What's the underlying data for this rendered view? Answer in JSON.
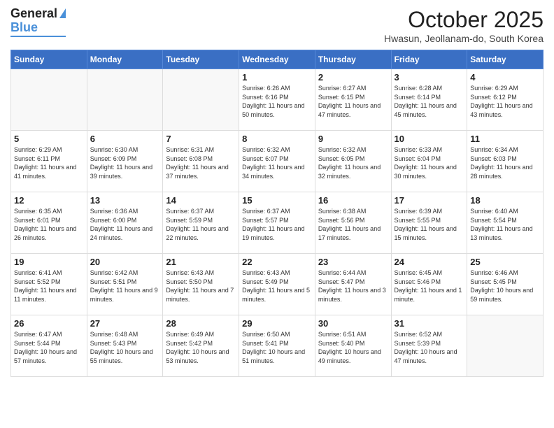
{
  "header": {
    "logo_general": "General",
    "logo_blue": "Blue",
    "month_title": "October 2025",
    "location": "Hwasun, Jeollanam-do, South Korea"
  },
  "days_of_week": [
    "Sunday",
    "Monday",
    "Tuesday",
    "Wednesday",
    "Thursday",
    "Friday",
    "Saturday"
  ],
  "weeks": [
    [
      {
        "day": "",
        "empty": true
      },
      {
        "day": "",
        "empty": true
      },
      {
        "day": "",
        "empty": true
      },
      {
        "day": "1",
        "sunrise": "6:26 AM",
        "sunset": "6:16 PM",
        "daylight": "11 hours and 50 minutes."
      },
      {
        "day": "2",
        "sunrise": "6:27 AM",
        "sunset": "6:15 PM",
        "daylight": "11 hours and 47 minutes."
      },
      {
        "day": "3",
        "sunrise": "6:28 AM",
        "sunset": "6:14 PM",
        "daylight": "11 hours and 45 minutes."
      },
      {
        "day": "4",
        "sunrise": "6:29 AM",
        "sunset": "6:12 PM",
        "daylight": "11 hours and 43 minutes."
      }
    ],
    [
      {
        "day": "5",
        "sunrise": "6:29 AM",
        "sunset": "6:11 PM",
        "daylight": "11 hours and 41 minutes."
      },
      {
        "day": "6",
        "sunrise": "6:30 AM",
        "sunset": "6:09 PM",
        "daylight": "11 hours and 39 minutes."
      },
      {
        "day": "7",
        "sunrise": "6:31 AM",
        "sunset": "6:08 PM",
        "daylight": "11 hours and 37 minutes."
      },
      {
        "day": "8",
        "sunrise": "6:32 AM",
        "sunset": "6:07 PM",
        "daylight": "11 hours and 34 minutes."
      },
      {
        "day": "9",
        "sunrise": "6:32 AM",
        "sunset": "6:05 PM",
        "daylight": "11 hours and 32 minutes."
      },
      {
        "day": "10",
        "sunrise": "6:33 AM",
        "sunset": "6:04 PM",
        "daylight": "11 hours and 30 minutes."
      },
      {
        "day": "11",
        "sunrise": "6:34 AM",
        "sunset": "6:03 PM",
        "daylight": "11 hours and 28 minutes."
      }
    ],
    [
      {
        "day": "12",
        "sunrise": "6:35 AM",
        "sunset": "6:01 PM",
        "daylight": "11 hours and 26 minutes."
      },
      {
        "day": "13",
        "sunrise": "6:36 AM",
        "sunset": "6:00 PM",
        "daylight": "11 hours and 24 minutes."
      },
      {
        "day": "14",
        "sunrise": "6:37 AM",
        "sunset": "5:59 PM",
        "daylight": "11 hours and 22 minutes."
      },
      {
        "day": "15",
        "sunrise": "6:37 AM",
        "sunset": "5:57 PM",
        "daylight": "11 hours and 19 minutes."
      },
      {
        "day": "16",
        "sunrise": "6:38 AM",
        "sunset": "5:56 PM",
        "daylight": "11 hours and 17 minutes."
      },
      {
        "day": "17",
        "sunrise": "6:39 AM",
        "sunset": "5:55 PM",
        "daylight": "11 hours and 15 minutes."
      },
      {
        "day": "18",
        "sunrise": "6:40 AM",
        "sunset": "5:54 PM",
        "daylight": "11 hours and 13 minutes."
      }
    ],
    [
      {
        "day": "19",
        "sunrise": "6:41 AM",
        "sunset": "5:52 PM",
        "daylight": "11 hours and 11 minutes."
      },
      {
        "day": "20",
        "sunrise": "6:42 AM",
        "sunset": "5:51 PM",
        "daylight": "11 hours and 9 minutes."
      },
      {
        "day": "21",
        "sunrise": "6:43 AM",
        "sunset": "5:50 PM",
        "daylight": "11 hours and 7 minutes."
      },
      {
        "day": "22",
        "sunrise": "6:43 AM",
        "sunset": "5:49 PM",
        "daylight": "11 hours and 5 minutes."
      },
      {
        "day": "23",
        "sunrise": "6:44 AM",
        "sunset": "5:47 PM",
        "daylight": "11 hours and 3 minutes."
      },
      {
        "day": "24",
        "sunrise": "6:45 AM",
        "sunset": "5:46 PM",
        "daylight": "11 hours and 1 minute."
      },
      {
        "day": "25",
        "sunrise": "6:46 AM",
        "sunset": "5:45 PM",
        "daylight": "10 hours and 59 minutes."
      }
    ],
    [
      {
        "day": "26",
        "sunrise": "6:47 AM",
        "sunset": "5:44 PM",
        "daylight": "10 hours and 57 minutes."
      },
      {
        "day": "27",
        "sunrise": "6:48 AM",
        "sunset": "5:43 PM",
        "daylight": "10 hours and 55 minutes."
      },
      {
        "day": "28",
        "sunrise": "6:49 AM",
        "sunset": "5:42 PM",
        "daylight": "10 hours and 53 minutes."
      },
      {
        "day": "29",
        "sunrise": "6:50 AM",
        "sunset": "5:41 PM",
        "daylight": "10 hours and 51 minutes."
      },
      {
        "day": "30",
        "sunrise": "6:51 AM",
        "sunset": "5:40 PM",
        "daylight": "10 hours and 49 minutes."
      },
      {
        "day": "31",
        "sunrise": "6:52 AM",
        "sunset": "5:39 PM",
        "daylight": "10 hours and 47 minutes."
      },
      {
        "day": "",
        "empty": true
      }
    ]
  ],
  "labels": {
    "sunrise": "Sunrise:",
    "sunset": "Sunset:",
    "daylight": "Daylight:"
  }
}
